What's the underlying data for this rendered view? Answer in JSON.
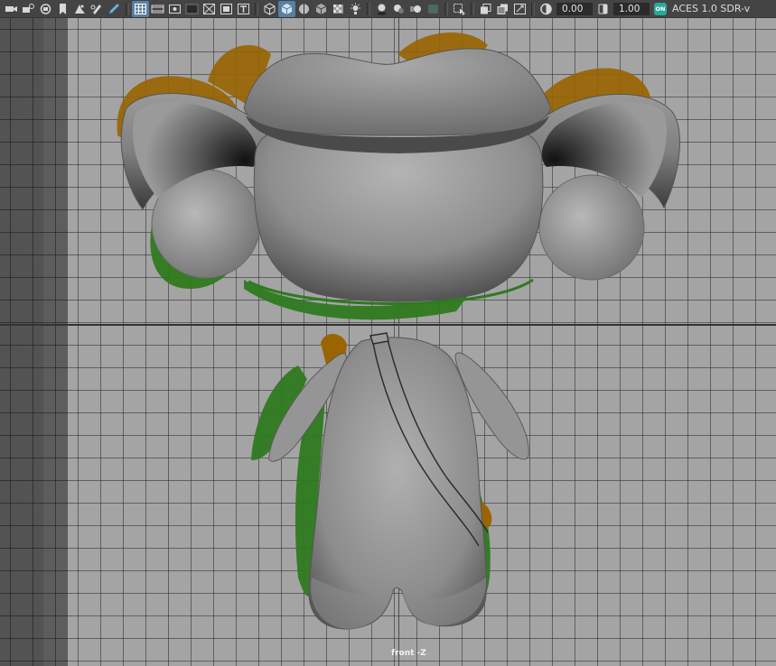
{
  "toolbar": {
    "icons": [
      "camera-icon",
      "select-camera-icon",
      "lock-camera-icon",
      "bookmark-icon",
      "image-plane-icon",
      "grease-pencil-icon",
      "grid-icon",
      "film-gate-icon",
      "resolution-gate-icon",
      "gate-mask-icon",
      "field-chart-icon",
      "safe-action-icon",
      "safe-title-icon",
      "wireframe-icon",
      "smooth-shade-icon",
      "wireframe-on-shaded-icon",
      "default-material-icon",
      "textured-icon",
      "use-lights-icon",
      "shadows-icon",
      "screen-space-ao-icon",
      "motion-blur-icon",
      "anti-alias-icon",
      "isolate-select-icon",
      "xray-icon",
      "xray-joints-icon",
      "xray-components-icon",
      "exposure-icon",
      "gamma-icon",
      "color-management-icon"
    ],
    "exposure_value": "0.00",
    "gamma_value": "1.00",
    "color_mgmt_badge": "ON",
    "view_transform": "ACES 1.0 SDR-v"
  },
  "viewport": {
    "camera_label": "front -Z"
  },
  "colors": {
    "viewport_bg": "#a4a4a4",
    "mesh_gray": "#8f8f8f",
    "wire_orange": "#9a6400",
    "wire_green": "#2f7a1f",
    "toolbar_bg": "#444444",
    "accent_blue": "#5a7fa0"
  }
}
